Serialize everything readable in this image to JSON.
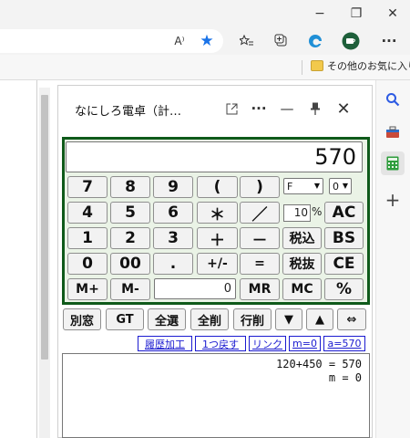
{
  "browser": {
    "window_controls": {
      "minimize": "−",
      "restore": "❐",
      "close": "✕"
    },
    "toolbar_icons": [
      "read-aloud",
      "favorite-star",
      "favorites-list",
      "collections",
      "edge-logo",
      "profile",
      "more"
    ],
    "read_aloud_glyph": "A⁾",
    "star_glyph": "★",
    "more_glyph": "···",
    "favorites_folder_label": "その他のお気に入り",
    "accent": "#1a73e8"
  },
  "sidebar": {
    "icons": [
      "search",
      "toolbox",
      "calculator",
      "add"
    ],
    "plus_glyph": "+"
  },
  "calc_window": {
    "title": "なにしろ電卓（計…",
    "controls": {
      "popout": "⧉",
      "more": "···",
      "minimize": "—",
      "pin": "📌",
      "close": "✕"
    }
  },
  "calculator": {
    "display": "570",
    "format_select": "F",
    "digits_select": "0",
    "decimal_digits": "10",
    "percent_label": "%",
    "memory_value": "0",
    "keys": {
      "k7": "7",
      "k8": "8",
      "k9": "9",
      "lparen": "(",
      "rparen": ")",
      "k4": "4",
      "k5": "5",
      "k6": "6",
      "mul": "＊",
      "div": "／",
      "ac": "AC",
      "k1": "1",
      "k2": "2",
      "k3": "3",
      "add": "＋",
      "sub": "－",
      "tax_in": "税込",
      "bs": "BS",
      "k0": "0",
      "k00": "00",
      "dot": ".",
      "neg": "+/-",
      "eq": "=",
      "tax_ex": "税抜",
      "ce": "CE",
      "mplus": "M+",
      "mminus": "M-",
      "mr": "MR",
      "mc": "MC",
      "pct": "%"
    },
    "panel_color": "#0f5a1a"
  },
  "function_bar": [
    "別窓",
    "GT",
    "全選",
    "全削",
    "行削",
    "▼",
    "▲",
    "⇔"
  ],
  "links": [
    "履歴加工",
    "1つ戻す",
    "リンク",
    "m=0",
    "a=570"
  ],
  "history": {
    "lines": [
      "120+450 = 570",
      "m = 0"
    ]
  }
}
